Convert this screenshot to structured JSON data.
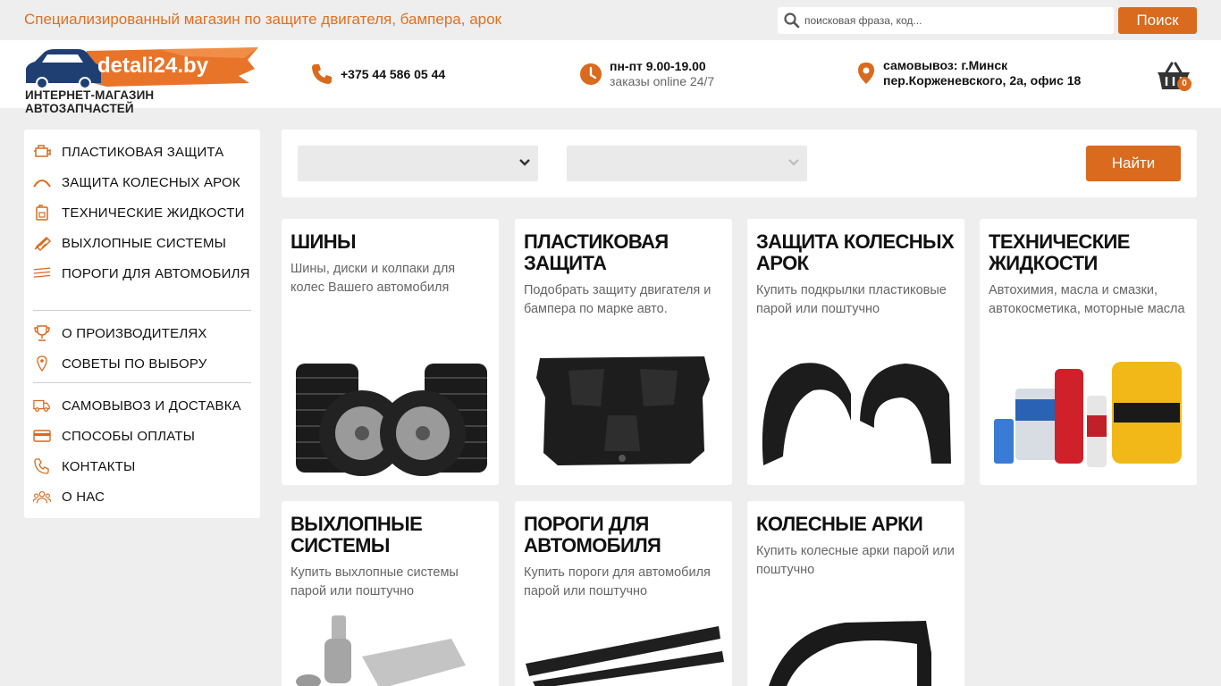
{
  "topbar": {
    "tagline": "Специализированный магазин по защите двигателя, бампера, арок",
    "search_placeholder": "поисковая фраза, код...",
    "search_button": "Поиск"
  },
  "header": {
    "logo_text": "detali24.by",
    "logo_subtitle": "ИНТЕРНЕТ-МАГАЗИН АВТОЗАПЧАСТЕЙ",
    "phone": "+375 44 586 05 44",
    "hours_line1": "пн-пт 9.00-19.00",
    "hours_line2": "заказы online 24/7",
    "address_line1": "самовывоз: г.Минск",
    "address_line2": "пер.Корженевского, 2а, офис 18",
    "cart_count": "0"
  },
  "sidebar": {
    "items": [
      {
        "label": "ПЛАСТИКОВАЯ ЗАЩИТА",
        "icon": "engine-icon"
      },
      {
        "label": "ЗАЩИТА КОЛЕСНЫХ АРОК",
        "icon": "arch-icon"
      },
      {
        "label": "ТЕХНИЧЕСКИЕ ЖИДКОСТИ",
        "icon": "canister-icon"
      },
      {
        "label": "ВЫХЛОПНЫЕ СИСТЕМЫ",
        "icon": "exhaust-icon"
      },
      {
        "label": "ПОРОГИ ДЛЯ АВТОМОБИЛЯ",
        "icon": "sill-icon"
      },
      {
        "label": "О ПРОИЗВОДИТЕЛЯХ",
        "icon": "trophy-icon"
      },
      {
        "label": "СОВЕТЫ ПО ВЫБОРУ",
        "icon": "pin-icon"
      },
      {
        "label": "САМОВЫВОЗ И ДОСТАВКА",
        "icon": "truck-icon"
      },
      {
        "label": "СПОСОБЫ ОПЛАТЫ",
        "icon": "card-icon"
      },
      {
        "label": "КОНТАКТЫ",
        "icon": "phone-icon"
      },
      {
        "label": "О НАС",
        "icon": "people-icon"
      }
    ]
  },
  "filter": {
    "select1_value": "",
    "select2_value": "",
    "find_button": "Найти"
  },
  "cards": [
    {
      "title": "ШИНЫ",
      "desc": "Шины, диски и колпаки для колес Вашего автомобиля"
    },
    {
      "title": "ПЛАСТИКОВАЯ ЗАЩИТА",
      "desc": "Подобрать защиту двигателя и бампера по марке авто."
    },
    {
      "title": "ЗАЩИТА КОЛЕСНЫХ АРОК",
      "desc": "Купить подкрылки пластиковые парой или поштучно"
    },
    {
      "title": "ТЕХНИЧЕСКИЕ ЖИДКОСТИ",
      "desc": "Автохимия, масла и смазки, автокосметика, моторные масла"
    },
    {
      "title": "ВЫХЛОПНЫЕ СИСТЕМЫ",
      "desc": "Купить выхлопные системы парой или поштучно"
    },
    {
      "title": "ПОРОГИ ДЛЯ АВТОМОБИЛЯ",
      "desc": "Купить пороги для автомобиля парой или поштучно"
    },
    {
      "title": "КОЛЕСНЫЕ АРКИ",
      "desc": "Купить колесные арки парой или поштучно"
    }
  ],
  "colors": {
    "accent": "#d96a1e",
    "tagline": "#e0701f",
    "logo_blue": "#1f3f73",
    "background": "#eeeeee"
  }
}
